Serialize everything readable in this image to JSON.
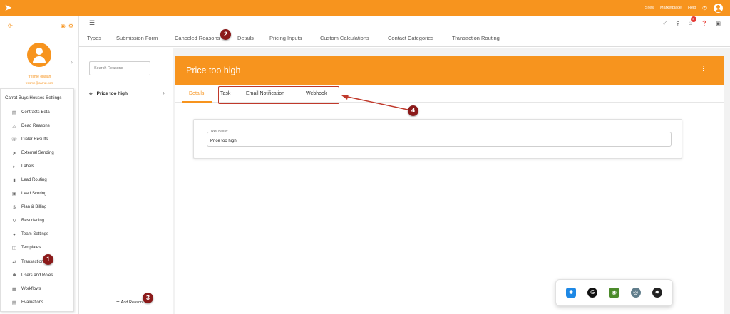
{
  "topbar": {
    "links": [
      "Sites",
      "Marketplace",
      "Help"
    ],
    "icons": [
      "carrot-logo-icon",
      "phone-icon",
      "user-avatar-icon"
    ]
  },
  "user": {
    "name": "tresme obalah",
    "email": "tresme@carrot.com"
  },
  "sidebar": {
    "section_title": "Carrot Buys Houses Settings",
    "items": [
      {
        "label": "Contracts Beta",
        "icon": "clipboard-icon"
      },
      {
        "label": "Dead Reasons",
        "icon": "warning-icon"
      },
      {
        "label": "Dialer Results",
        "icon": "phone-list-icon"
      },
      {
        "label": "External Sending",
        "icon": "send-icon"
      },
      {
        "label": "Labels",
        "icon": "label-icon"
      },
      {
        "label": "Lead Routing",
        "icon": "bar-chart-icon"
      },
      {
        "label": "Lead Scoring",
        "icon": "scoring-icon"
      },
      {
        "label": "Plan & Billing",
        "icon": "dollar-icon"
      },
      {
        "label": "Resurfacing",
        "icon": "refresh-icon"
      },
      {
        "label": "Team Settings",
        "icon": "team-icon"
      },
      {
        "label": "Templates",
        "icon": "templates-icon"
      },
      {
        "label": "Transactions",
        "icon": "sync-icon"
      },
      {
        "label": "Users and Roles",
        "icon": "users-icon"
      },
      {
        "label": "Workflows",
        "icon": "workflow-icon"
      },
      {
        "label": "Evaluations",
        "icon": "evaluation-icon"
      }
    ]
  },
  "header": {
    "notification_count": "3",
    "icons": [
      "hamburger-icon",
      "fullscreen-icon",
      "search-icon",
      "bell-icon",
      "help-icon",
      "book-icon"
    ]
  },
  "settings_tabs": [
    "Types",
    "Submission Form",
    "Canceled Reasons",
    "Details",
    "Pricing Inputs",
    "Custom Calculations",
    "Contact Categories",
    "Transaction Routing"
  ],
  "reasons": {
    "search_placeholder": "Search Reasons",
    "items": [
      "Price too high"
    ],
    "add_label": "Add Reason"
  },
  "detail": {
    "title": "Price too high",
    "tabs": [
      "Details",
      "Task",
      "Email Notification",
      "Webhook"
    ],
    "active_tab": "Details",
    "field_label": "Type Name*",
    "field_value": "Price too high"
  },
  "annotations": [
    "1",
    "2",
    "3",
    "4"
  ],
  "tray": {
    "icons": [
      "bluetooth-icon",
      "grammarly-icon",
      "nvidia-icon",
      "network-icon",
      "ai-app-icon"
    ]
  },
  "colors": {
    "accent": "#f7941e",
    "annotation": "#8b1a1a",
    "highlight": "#c0392b"
  }
}
